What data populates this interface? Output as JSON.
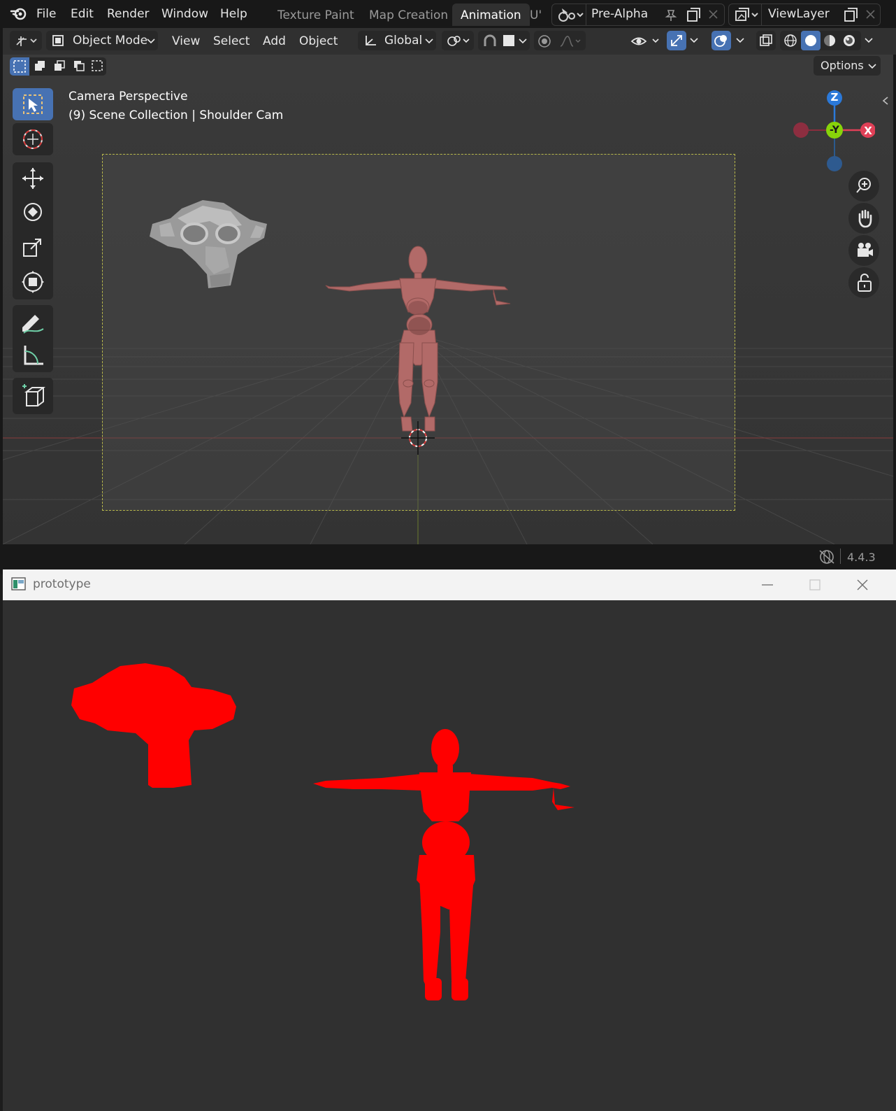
{
  "topbar": {
    "menus": [
      "File",
      "Edit",
      "Render",
      "Window",
      "Help"
    ],
    "workspace_tabs": [
      {
        "label": "Texture Paint",
        "active": false
      },
      {
        "label": "Map Creation",
        "active": false
      },
      {
        "label": "Animation",
        "active": true
      },
      {
        "label": "U'",
        "active": false
      }
    ],
    "scene_name": "Pre-Alpha",
    "view_layer": "ViewLayer"
  },
  "header": {
    "mode": "Object Mode",
    "menus": [
      "View",
      "Select",
      "Add",
      "Object"
    ],
    "orientation": "Global",
    "options_label": "Options"
  },
  "viewport": {
    "overlay_title": "Camera Perspective",
    "overlay_subtitle": "(9) Scene Collection | Shoulder Cam",
    "gizmo": {
      "z": "Z",
      "y": "-Y",
      "x": "X"
    }
  },
  "statusbar": {
    "version": "4.4.3"
  },
  "prototype": {
    "title": "prototype",
    "fill_color": "#ff0000"
  },
  "colors": {
    "accent": "#4772b3",
    "axis_x": "#e04057",
    "axis_y": "#88d40a",
    "axis_z": "#2b79d9"
  }
}
